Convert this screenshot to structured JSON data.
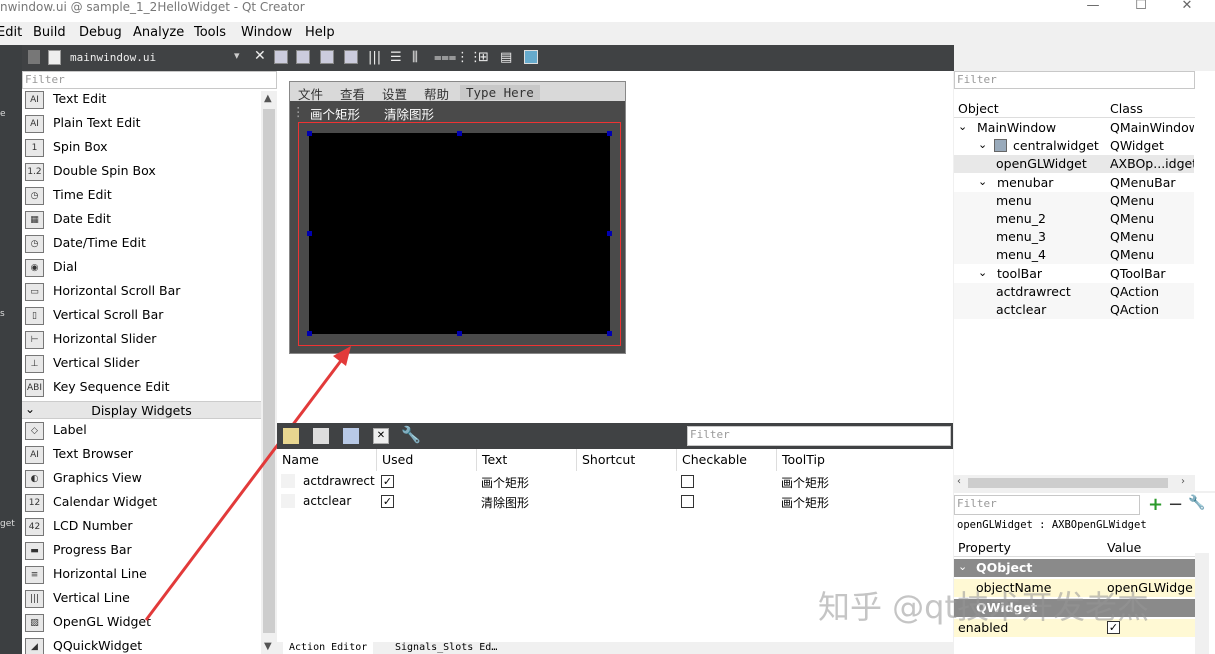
{
  "window": {
    "title": "nwindow.ui @ sample_1_2HelloWidget - Qt Creator",
    "minimize": "—",
    "maximize": "☐",
    "close": "✕"
  },
  "menubar": [
    "Edit",
    "Build",
    "Debug",
    "Analyze",
    "Tools",
    "Window",
    "Help"
  ],
  "left_strip": [
    "e",
    "s",
    "get"
  ],
  "editor": {
    "filename": "mainwindow.ui",
    "close": "✕"
  },
  "widget_box": {
    "filter_placeholder": "Filter",
    "items_top": [
      {
        "label": "Text Edit",
        "icon": "AI"
      },
      {
        "label": "Plain Text Edit",
        "icon": "AI"
      },
      {
        "label": "Spin Box",
        "icon": "1"
      },
      {
        "label": "Double Spin Box",
        "icon": "1.2"
      },
      {
        "label": "Time Edit",
        "icon": "◷"
      },
      {
        "label": "Date Edit",
        "icon": "▦"
      },
      {
        "label": "Date/Time Edit",
        "icon": "◷"
      },
      {
        "label": "Dial",
        "icon": "◉"
      },
      {
        "label": "Horizontal Scroll Bar",
        "icon": "▭"
      },
      {
        "label": "Vertical Scroll Bar",
        "icon": "▯"
      },
      {
        "label": "Horizontal Slider",
        "icon": "⊢"
      },
      {
        "label": "Vertical Slider",
        "icon": "⊥"
      },
      {
        "label": "Key Sequence Edit",
        "icon": "ABI"
      }
    ],
    "category": "Display Widgets",
    "items_bottom": [
      {
        "label": "Label",
        "icon": "◇"
      },
      {
        "label": "Text Browser",
        "icon": "AI"
      },
      {
        "label": "Graphics View",
        "icon": "◐"
      },
      {
        "label": "Calendar Widget",
        "icon": "12"
      },
      {
        "label": "LCD Number",
        "icon": "42"
      },
      {
        "label": "Progress Bar",
        "icon": "▬"
      },
      {
        "label": "Horizontal Line",
        "icon": "≡"
      },
      {
        "label": "Vertical Line",
        "icon": "|||"
      },
      {
        "label": "OpenGL Widget",
        "icon": "▨"
      },
      {
        "label": "QQuickWidget",
        "icon": "◢"
      }
    ]
  },
  "form": {
    "menus": [
      "文件",
      "查看",
      "设置",
      "帮助",
      "Type Here"
    ],
    "toolbar": [
      "画个矩形",
      "清除图形"
    ]
  },
  "action_editor": {
    "filter_placeholder": "Filter",
    "columns": [
      "Name",
      "Used",
      "Text",
      "Shortcut",
      "Checkable",
      "ToolTip"
    ],
    "rows": [
      {
        "name": "actdrawrect",
        "used": "✓",
        "text": "画个矩形",
        "shortcut": "",
        "checkable": "",
        "tooltip": "画个矩形"
      },
      {
        "name": "actclear",
        "used": "✓",
        "text": "清除图形",
        "shortcut": "",
        "checkable": "",
        "tooltip": "画个矩形"
      }
    ],
    "tabs": [
      "Action Editor",
      "Signals_Slots Ed…"
    ]
  },
  "object_inspector": {
    "filter_placeholder": "Filter",
    "columns": [
      "Object",
      "Class"
    ],
    "rows": [
      {
        "name": "MainWindow",
        "cls": "QMainWindow",
        "level": 0,
        "arrow": "⌄"
      },
      {
        "name": "centralwidget",
        "cls": "QWidget",
        "level": 1,
        "arrow": "⌄"
      },
      {
        "name": "openGLWidget",
        "cls": "AXBOp...idget",
        "level": 2,
        "arrow": ""
      },
      {
        "name": "menubar",
        "cls": "QMenuBar",
        "level": 1,
        "arrow": "⌄"
      },
      {
        "name": "menu",
        "cls": "QMenu",
        "level": 2,
        "arrow": ""
      },
      {
        "name": "menu_2",
        "cls": "QMenu",
        "level": 2,
        "arrow": ""
      },
      {
        "name": "menu_3",
        "cls": "QMenu",
        "level": 2,
        "arrow": ""
      },
      {
        "name": "menu_4",
        "cls": "QMenu",
        "level": 2,
        "arrow": ""
      },
      {
        "name": "toolBar",
        "cls": "QToolBar",
        "level": 1,
        "arrow": "⌄"
      },
      {
        "name": "actdrawrect",
        "cls": "QAction",
        "level": 2,
        "arrow": ""
      },
      {
        "name": "actclear",
        "cls": "QAction",
        "level": 2,
        "arrow": ""
      }
    ]
  },
  "property_editor": {
    "filter_placeholder": "Filter",
    "subject": "openGLWidget : AXBOpenGLWidget",
    "columns": [
      "Property",
      "Value"
    ],
    "group": "QObject",
    "rows": [
      {
        "name": "objectName",
        "value": "openGLWidget"
      },
      {
        "name": "QWidget",
        "value": ""
      },
      {
        "name": "enabled",
        "value": "✓"
      }
    ]
  },
  "watermark": "知乎 @qt技术开发老杰",
  "colors": {
    "dark_bar": "#404244",
    "selection": "#e8e8e8",
    "arrow": "#e23a3a",
    "group": "#8a8a8a",
    "prop_yellow": "#fff9d4"
  }
}
